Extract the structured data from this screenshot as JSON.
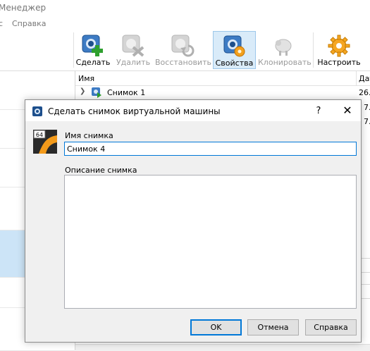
{
  "window": {
    "title": "Менеджер"
  },
  "menu": {
    "items": [
      "с",
      "Справка"
    ]
  },
  "toolbar": {
    "buttons": [
      {
        "label": "Сделать",
        "icon": "take-snapshot-icon",
        "state": "enabled"
      },
      {
        "label": "Удалить",
        "icon": "delete-snapshot-icon",
        "state": "disabled"
      },
      {
        "label": "Восстановить",
        "icon": "restore-snapshot-icon",
        "state": "disabled"
      },
      {
        "label": "Свойства",
        "icon": "snapshot-properties-icon",
        "state": "active"
      },
      {
        "label": "Клонировать",
        "icon": "clone-sheep-icon",
        "state": "disabled"
      },
      {
        "label": "Настроить",
        "icon": "settings-gear-icon",
        "state": "enabled"
      }
    ]
  },
  "snapshots": {
    "col_name": "Имя",
    "col_date": "Дат",
    "rows": [
      {
        "name": "Снимок 1",
        "date": "26."
      }
    ],
    "partial_dates": [
      "7.",
      "7."
    ]
  },
  "dialog": {
    "title": "Сделать снимок виртуальной машины",
    "help_label": "?",
    "close_label": "✕",
    "os_badge": "64",
    "name_label": "Имя снимка",
    "name_value": "Снимок 4",
    "desc_label": "Описание снимка",
    "desc_value": "",
    "ok_label": "OK",
    "cancel_label": "Отмена",
    "help_button_label": "Справка"
  },
  "colors": {
    "accent": "#0078d7",
    "active_toolbar_bg": "#d9ebf9",
    "selected_row_bg": "#cce4f7",
    "dialog_bg": "#f0f0f0"
  }
}
